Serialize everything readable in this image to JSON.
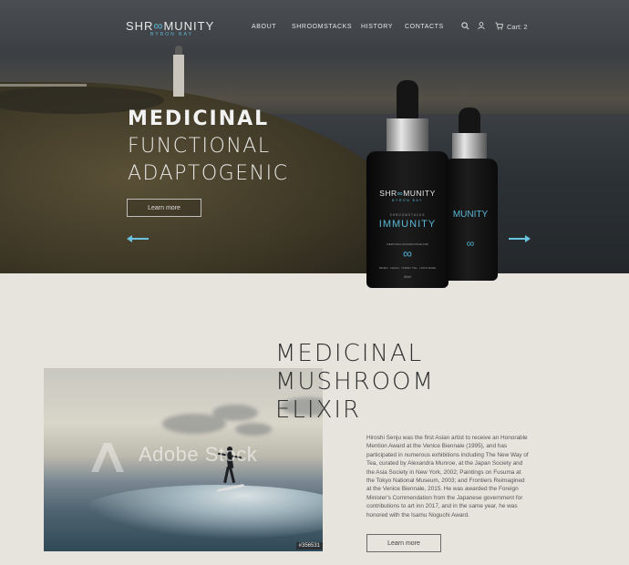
{
  "brand": {
    "logo_left": "SHR",
    "logo_symbol": "∞",
    "logo_right": "MUNITY",
    "logo_sub": "BYRON BAY"
  },
  "nav": {
    "items": [
      "ABOUT",
      "SHROOMSTACKS",
      "HISTORY",
      "CONTACTS"
    ],
    "search_icon": "search-icon",
    "account_icon": "user-icon",
    "cart_icon": "cart-icon",
    "cart_label": "Cart: 2"
  },
  "hero": {
    "heading": "MEDICINAL",
    "line2": "FUNCTIONAL",
    "line3": "ADAPTOGENIC",
    "button": "Learn more",
    "prev_icon": "arrow-left-icon",
    "next_icon": "arrow-right-icon"
  },
  "product": {
    "logo_left": "SHR",
    "logo_symbol": "∞",
    "logo_right": "MUNITY",
    "logo_sub": "BYRON BAY",
    "line": "SHROOMSTACKS",
    "name": "IMMUNITY",
    "desc": "MEDICINAL MUSHROOM ELIXIR",
    "ingredients": "REISHI · CHAGA · TURKEY TAIL · LION'S MANE",
    "volume": "50ml",
    "dna_icon": "dna-icon"
  },
  "elixir": {
    "title_line1": "MEDICINAL",
    "title_line2": "MUSHROOM",
    "title_line3": "ELIXIR",
    "body": "Hiroshi Senju was the first Asian artist to receive an Honorable Mention Award at the Venice Biennale (1995), and has participated in numerous exhibitions including The New Way of Tea, curated by Alexandra Munroe, at the Japan Society and the Asia Society in New York, 2002; Paintings on Fusuma at the Tokyo National Museum, 2003; and Frontiers Reimagined at the Venice Biennale, 2015. He was awarded the Foreign Minister's Commendation from the Japanese government for contributions to art inn 2017, and in the same year, he was honored with the Isamu Noguchi Award.",
    "button": "Learn more"
  },
  "photo": {
    "watermark": "Adobe Stock",
    "stock_id": "#356531"
  },
  "colors": {
    "accent": "#5bb7d6",
    "page_bg": "#e7e4de",
    "dark_text": "#2f2f2f"
  }
}
